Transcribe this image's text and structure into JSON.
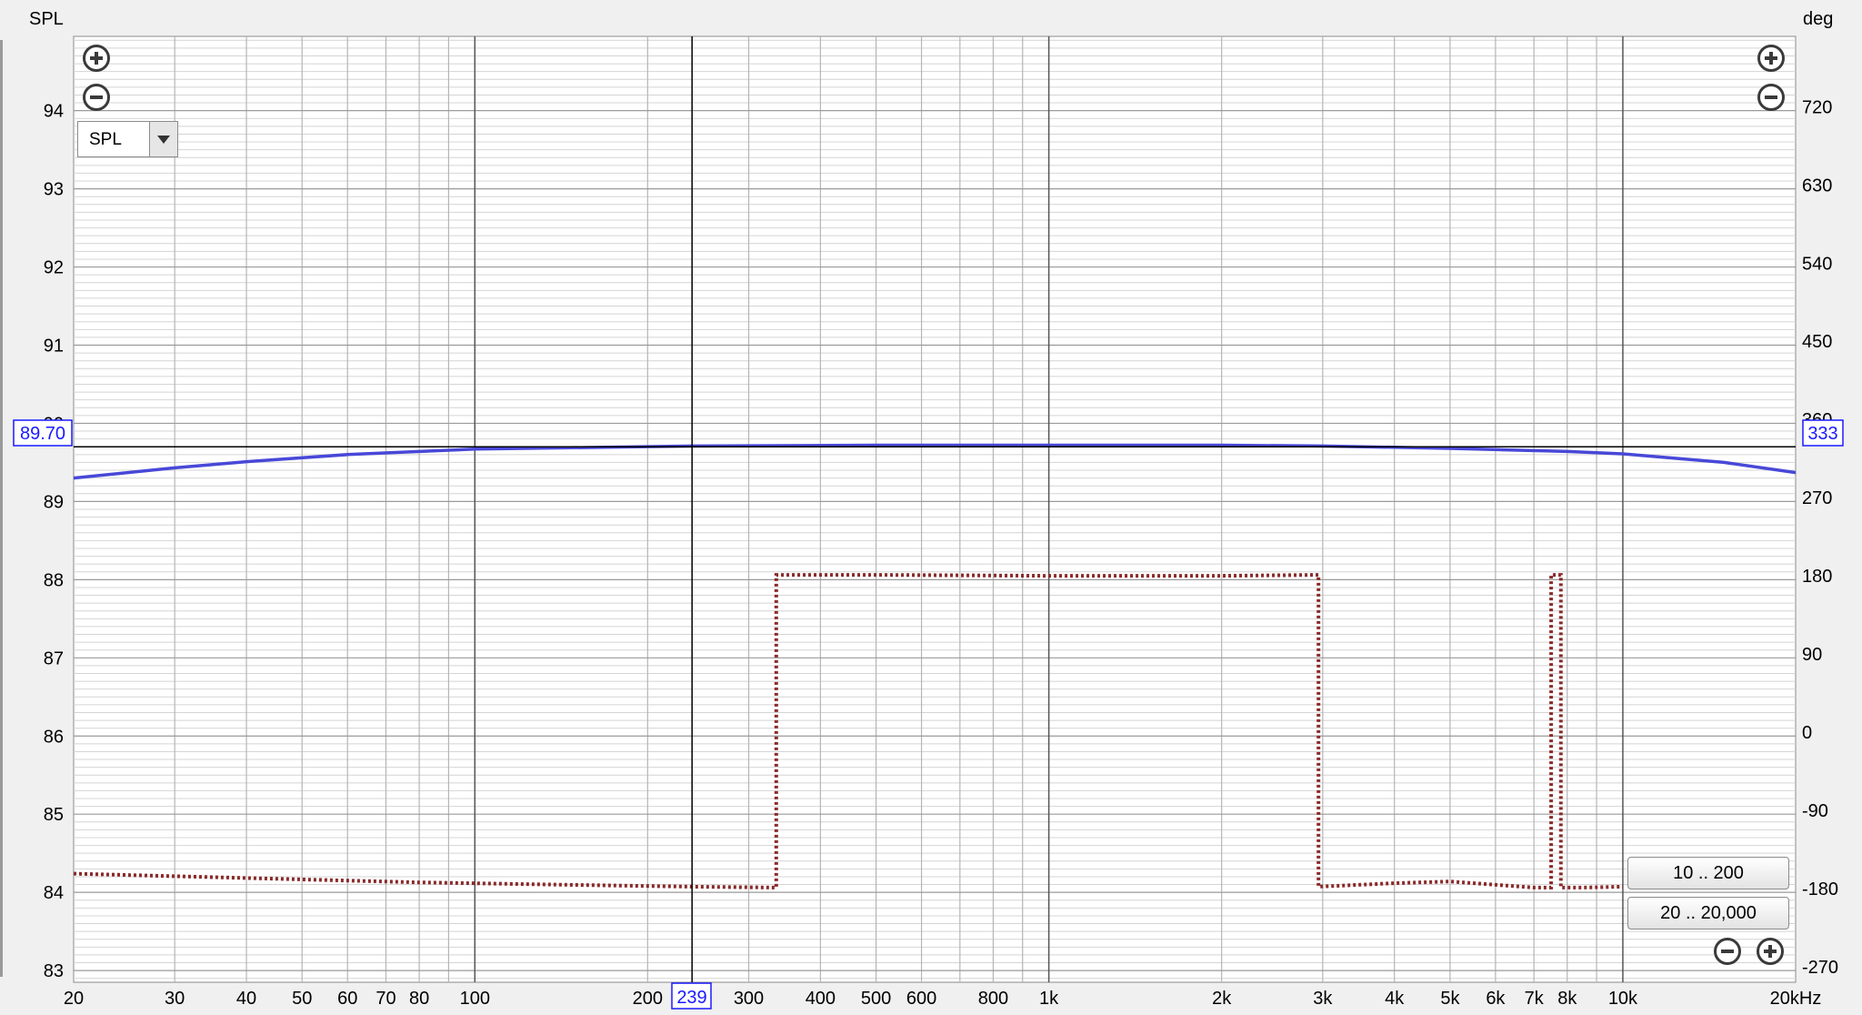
{
  "colors": {
    "spl_trace": "#4848d8",
    "phase_trace": "#8a2a2a",
    "cursor_readout": "#1a1aff",
    "grid_major": "#9a9a9a",
    "grid_minor": "#d4d4d4",
    "plot_bg": "#ffffff",
    "panel_bg": "#f0f0f0"
  },
  "icons": {
    "zoom_in": "circle-plus-icon",
    "zoom_out": "circle-minus-icon",
    "dropdown": "chevron-down-icon"
  },
  "controls": {
    "trace_select_value": "SPL",
    "range_low_label": "10 .. 200",
    "range_full_label": "20 .. 20,000"
  },
  "cursor": {
    "freq_hz": 239,
    "freq_label": "239",
    "spl_value": 89.7,
    "spl_label": "89.70",
    "phase_value": 333,
    "phase_label": "333"
  },
  "chart_data": {
    "type": "line",
    "xscale": "log",
    "xlim": [
      20,
      20000
    ],
    "ylim": [
      82.85,
      94.95
    ],
    "y2lim": [
      -288,
      801
    ],
    "left_axis_title": "SPL",
    "right_axis_title": "deg",
    "x_unit_suffix": "kHz",
    "y_ticks": [
      83,
      84,
      85,
      86,
      87,
      88,
      89,
      90,
      91,
      92,
      93,
      94
    ],
    "y_tick_labels": [
      "83",
      "84",
      "85",
      "86",
      "87",
      "88",
      "89",
      "90",
      "91",
      "92",
      "93",
      "94"
    ],
    "y2_ticks": [
      -270,
      -180,
      -90,
      0,
      90,
      180,
      270,
      360,
      450,
      540,
      630,
      720
    ],
    "y2_tick_labels": [
      "-270",
      "-180",
      "-90",
      "0",
      "90",
      "180",
      "270",
      "360",
      "450",
      "540",
      "630",
      "720"
    ],
    "x_ticks": [
      20,
      30,
      40,
      50,
      60,
      70,
      80,
      100,
      200,
      300,
      400,
      500,
      600,
      800,
      1000,
      2000,
      3000,
      4000,
      5000,
      6000,
      7000,
      8000,
      10000
    ],
    "x_tick_labels": [
      "20",
      "30",
      "40",
      "50",
      "60",
      "70",
      "80",
      "100",
      "200",
      "300",
      "400",
      "500",
      "600",
      "800",
      "1k",
      "2k",
      "3k",
      "4k",
      "5k",
      "6k",
      "7k",
      "8k",
      "10k"
    ],
    "x_end_label": "20kHz",
    "x_major_grid": [
      100,
      1000,
      10000
    ],
    "x_minor_grid": [
      30,
      40,
      50,
      60,
      70,
      80,
      90,
      200,
      300,
      400,
      500,
      600,
      700,
      800,
      900,
      2000,
      3000,
      4000,
      5000,
      6000,
      7000,
      8000,
      9000
    ],
    "grid": true,
    "series": [
      {
        "axis": "left",
        "style": "solid",
        "x": [
          20,
          30,
          40,
          60,
          100,
          239,
          500,
          1000,
          2000,
          3000,
          5000,
          8000,
          10000,
          15000,
          20000
        ],
        "y": [
          89.3,
          89.43,
          89.51,
          89.6,
          89.67,
          89.71,
          89.72,
          89.72,
          89.72,
          89.71,
          89.68,
          89.64,
          89.61,
          89.5,
          89.37
        ]
      },
      {
        "axis": "right",
        "style": "dotted",
        "x": [
          20,
          40,
          80,
          150,
          239,
          335,
          335,
          500,
          1000,
          2000,
          2950,
          2950,
          4000,
          5000,
          7000,
          7500,
          7500,
          7800,
          7800,
          8500,
          10000
        ],
        "y": [
          -163,
          -168,
          -173,
          -176,
          -178,
          -179,
          181,
          181,
          180,
          180,
          181,
          -178,
          -174,
          -172,
          -179,
          -179,
          181,
          181,
          -179,
          -179,
          -178
        ]
      }
    ]
  }
}
